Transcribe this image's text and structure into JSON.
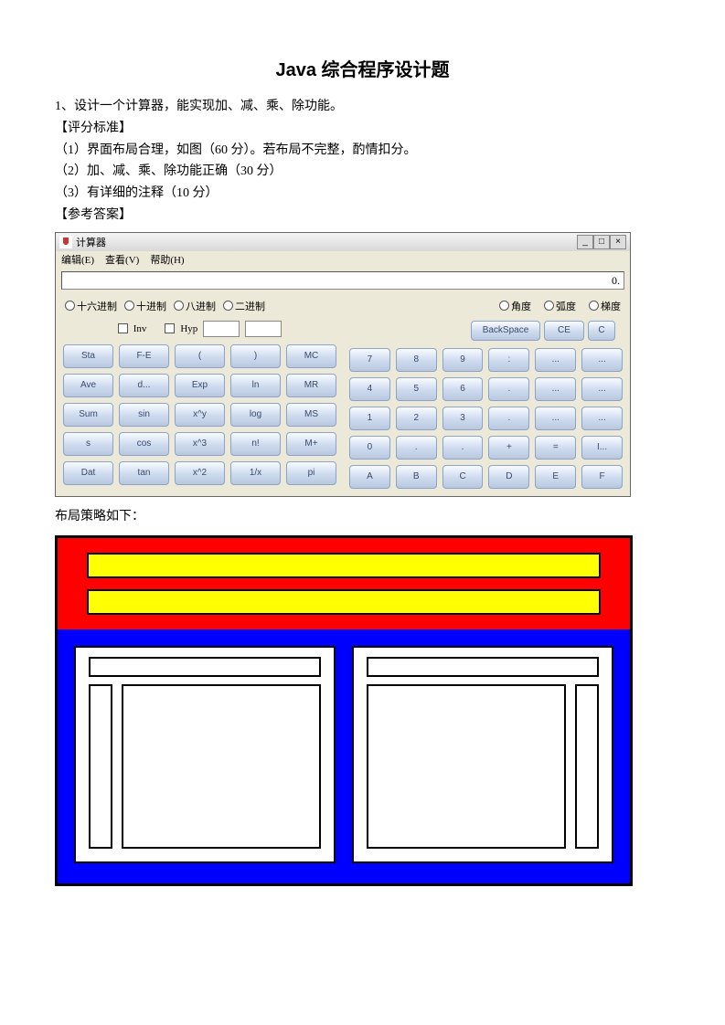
{
  "title": "Java 综合程序设计题",
  "q1": "1、设计一个计算器，能实现加、减、乘、除功能。",
  "std_h": "【评分标准】",
  "std1": "（1）界面布局合理，如图（60 分）。若布局不完整，酌情扣分。",
  "std2": "（2）加、减、乘、除功能正确（30 分）",
  "std3": "（3）有详细的注释（10 分）",
  "ans_h": "【参考答案】",
  "layout_caption": "布局策略如下：",
  "calc": {
    "title": "计算器",
    "menu": {
      "edit": "编辑(E)",
      "view": "查看(V)",
      "help": "帮助(H)"
    },
    "display": "0.",
    "winbtns": {
      "min": "_",
      "max": "□",
      "close": "×"
    },
    "left_radios": [
      "十六进制",
      "十进制",
      "八进制",
      "二进制"
    ],
    "right_radios": [
      "角度",
      "弧度",
      "梯度"
    ],
    "inv": "Inv",
    "hyp": "Hyp",
    "backspace": "BackSpace",
    "ce": "CE",
    "c": "C",
    "left_grid": [
      "Sta",
      "F-E",
      "(",
      ")",
      "MC",
      "Ave",
      "d...",
      "Exp",
      "ln",
      "MR",
      "Sum",
      "sin",
      "x^y",
      "log",
      "MS",
      "s",
      "cos",
      "x^3",
      "n!",
      "M+",
      "Dat",
      "tan",
      "x^2",
      "1/x",
      "pi"
    ],
    "right_grid": [
      "7",
      "8",
      "9",
      ":",
      "...",
      "...",
      "4",
      "5",
      "6",
      ".",
      "...",
      "...",
      "1",
      "2",
      "3",
      ".",
      "...",
      "...",
      "0",
      ".",
      ".",
      "+",
      "=",
      "I...",
      "A",
      "B",
      "C",
      "D",
      "E",
      "F"
    ]
  }
}
